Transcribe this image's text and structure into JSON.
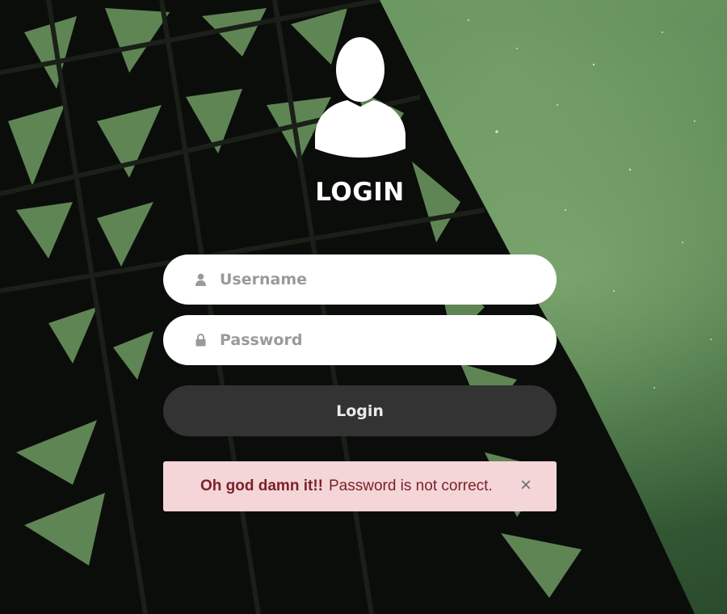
{
  "page": {
    "title": "LOGIN"
  },
  "form": {
    "username_placeholder": "Username",
    "password_placeholder": "Password",
    "login_label": "Login"
  },
  "alert": {
    "strong_text": "Oh god damn it!!",
    "message": "Password is not correct.",
    "close_symbol": "×"
  },
  "icons": {
    "avatar": "user-avatar-icon",
    "username": "user-icon",
    "password": "lock-icon",
    "close": "close-icon"
  },
  "colors": {
    "button_bg": "#333333",
    "alert_bg": "#f4d5d8",
    "alert_text": "#7a2328",
    "field_bg": "#ffffff"
  }
}
